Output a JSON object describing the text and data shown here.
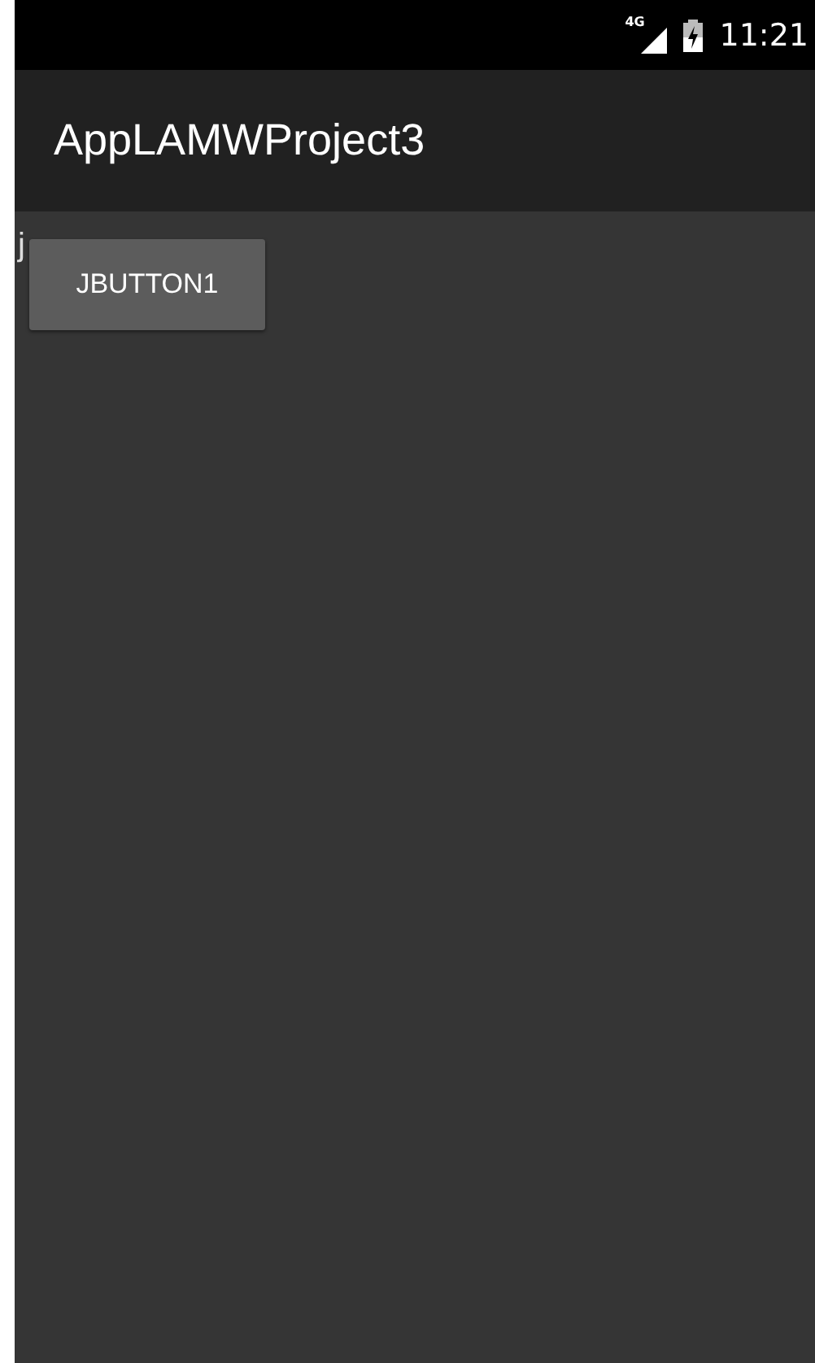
{
  "status_bar": {
    "network": "4G",
    "time": "11:21"
  },
  "action_bar": {
    "title": "AppLAMWProject3"
  },
  "content": {
    "text_view": "j",
    "button": "JBUTTON1"
  }
}
